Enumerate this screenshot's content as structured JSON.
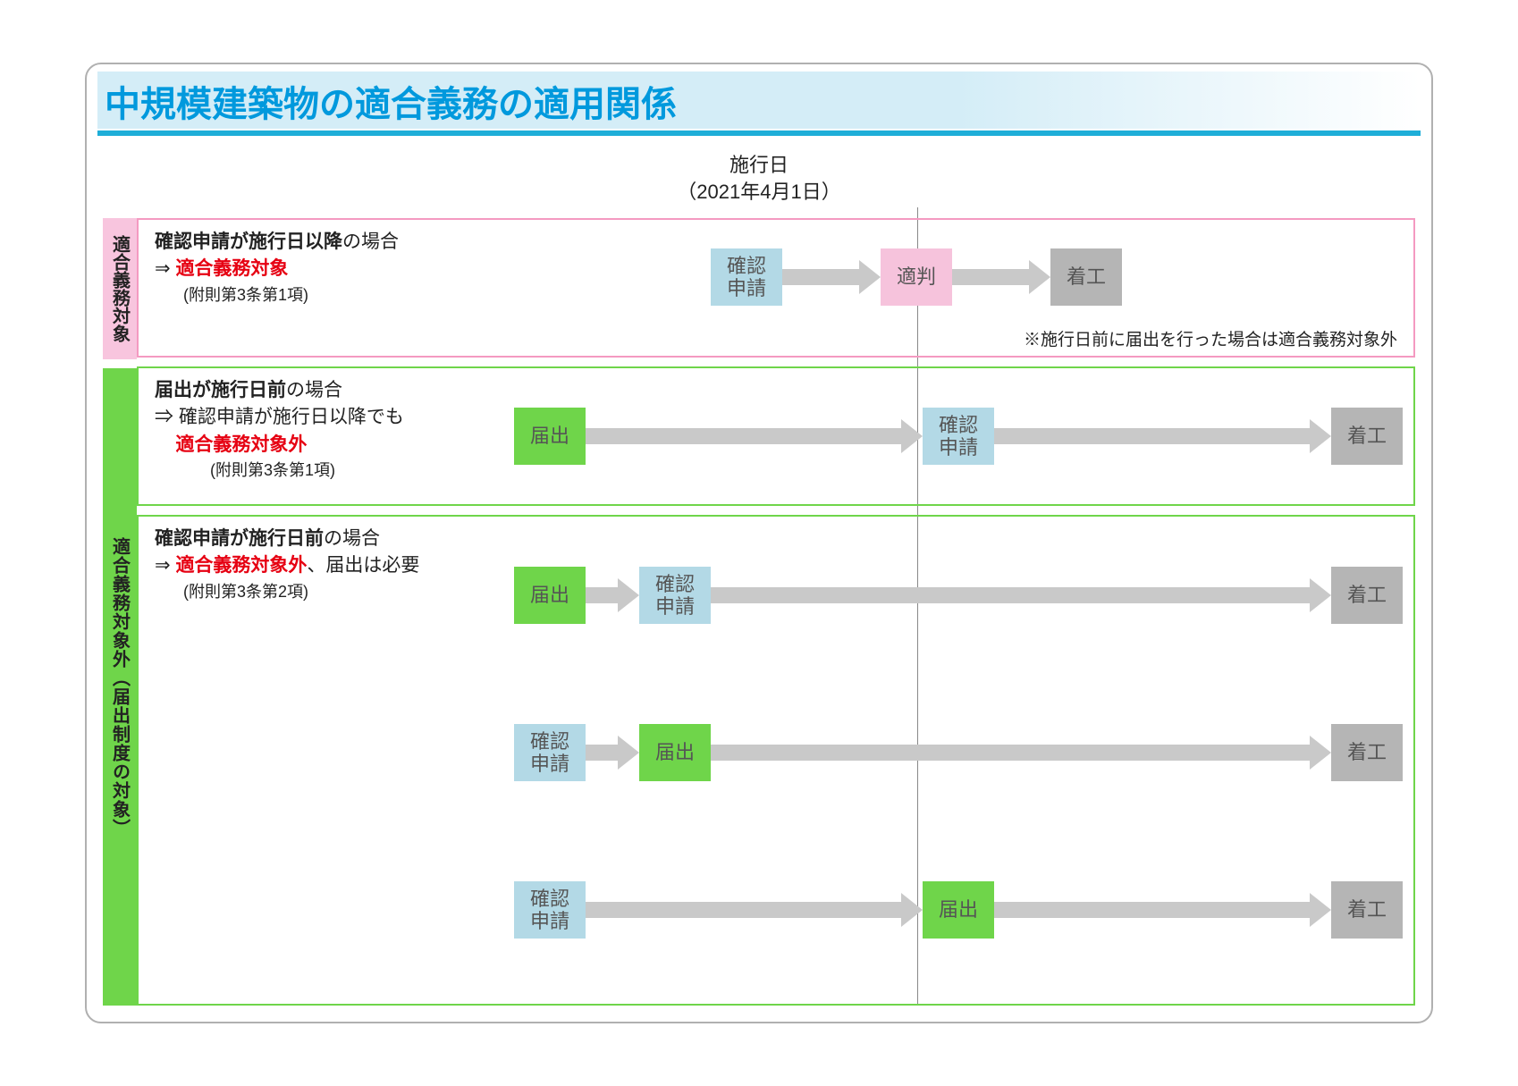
{
  "title": "中規模建築物の適合義務の適用関係",
  "effective_date": {
    "label_top": "施行日",
    "label_bottom": "（2021年4月1日）"
  },
  "side": {
    "target": "適合義務対象",
    "exempt": "適合義務対象外（届出制度の対象）"
  },
  "cases": [
    {
      "heading_bold": "確認申請が施行日以降",
      "heading_rest": "の場合",
      "arrow": "⇒ ",
      "result_red": "適合義務対象",
      "sub": "(附則第3条第1項)",
      "note": "※施行日前に届出を行った場合は適合義務対象外",
      "flow": [
        {
          "type": "box",
          "style": "blue",
          "text": "確認\n申請"
        },
        {
          "type": "arrow",
          "len": "med"
        },
        {
          "type": "box",
          "style": "pinkb",
          "text": "適判"
        },
        {
          "type": "arrow",
          "len": "med"
        },
        {
          "type": "box",
          "style": "gray",
          "text": "着工"
        }
      ]
    },
    {
      "heading_bold": "届出が施行日前",
      "heading_rest": "の場合",
      "arrow": "⇒ ",
      "line2_plain": "確認申請が施行日以降でも",
      "result_red": "適合義務対象外",
      "sub": "(附則第3条第1項)",
      "flow": [
        {
          "type": "box",
          "style": "greenb",
          "text": "届出"
        },
        {
          "type": "arrow"
        },
        {
          "type": "box",
          "style": "blue",
          "text": "確認\n申請"
        },
        {
          "type": "arrow"
        },
        {
          "type": "box",
          "style": "gray",
          "text": "着工"
        }
      ]
    },
    {
      "heading_bold": "確認申請が施行日前",
      "heading_rest": "の場合",
      "arrow": "⇒ ",
      "result_red": "適合義務対象外",
      "extra_plain": "、届出は必要",
      "sub": "(附則第3条第2項)",
      "flow": [
        {
          "type": "box",
          "style": "greenb",
          "text": "届出"
        },
        {
          "type": "arrow",
          "len": "short"
        },
        {
          "type": "box",
          "style": "blue",
          "text": "確認\n申請"
        },
        {
          "type": "arrow"
        },
        {
          "type": "box",
          "style": "gray",
          "text": "着工"
        }
      ]
    },
    {
      "flow": [
        {
          "type": "box",
          "style": "blue",
          "text": "確認\n申請"
        },
        {
          "type": "arrow",
          "len": "short"
        },
        {
          "type": "box",
          "style": "greenb",
          "text": "届出"
        },
        {
          "type": "arrow"
        },
        {
          "type": "box",
          "style": "gray",
          "text": "着工"
        }
      ]
    },
    {
      "flow": [
        {
          "type": "box",
          "style": "blue",
          "text": "確認\n申請"
        },
        {
          "type": "arrow"
        },
        {
          "type": "box",
          "style": "greenb",
          "text": "届出"
        },
        {
          "type": "arrow"
        },
        {
          "type": "box",
          "style": "gray",
          "text": "着工"
        }
      ]
    }
  ]
}
